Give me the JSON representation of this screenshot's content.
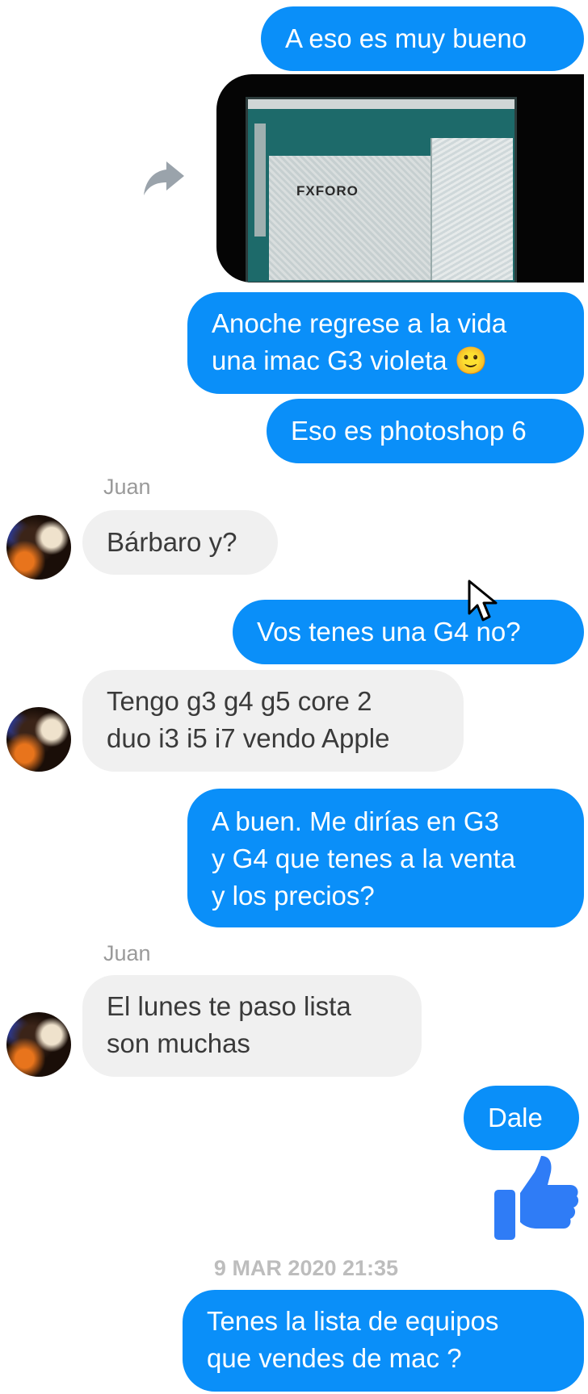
{
  "contact_name": "Juan",
  "messages": [
    {
      "text": "A eso es muy bueno"
    },
    {
      "image_label": "FXFORO"
    },
    {
      "lines": [
        "Anoche regrese a la vida",
        "una imac G3 violeta 🙂"
      ]
    },
    {
      "text": "Eso es photoshop 6"
    },
    {
      "sender": "Juan",
      "text": "Bárbaro y?"
    },
    {
      "text": "Vos tenes una G4 no?"
    },
    {
      "lines": [
        "Tengo g3 g4 g5 core 2",
        "duo i3 i5 i7 vendo Apple"
      ]
    },
    {
      "lines": [
        "A buen. Me dirías en G3",
        "y G4 que tenes a la venta",
        "y los precios?"
      ]
    },
    {
      "sender": "Juan",
      "lines": [
        "El lunes te paso lista",
        "son muchas"
      ]
    },
    {
      "text": "Dale"
    },
    {
      "lines": [
        "Tenes la lista de equipos",
        "que vendes de mac ?"
      ]
    }
  ],
  "timestamp": "9 MAR 2020 21:35",
  "colors": {
    "outgoing": "#0a8ff9",
    "incoming": "#f0f0f0",
    "like": "#2f7cf6"
  },
  "icons": [
    "forward-icon",
    "thumbs-up-icon",
    "cursor-icon",
    "avatar"
  ]
}
